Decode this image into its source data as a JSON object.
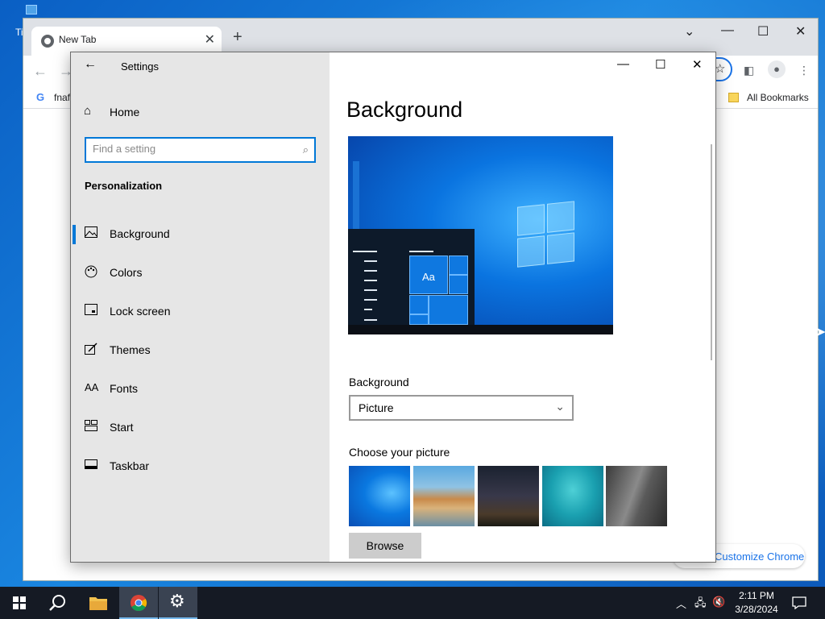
{
  "desktop": {
    "partial_label": "Ti"
  },
  "chrome": {
    "tab_title": "New Tab",
    "tab_close": "✕",
    "new_tab": "+",
    "bookmark_letter": "G",
    "bookmark_text": "fnaf",
    "all_bookmarks": "All Bookmarks",
    "customize": "Customize Chrome",
    "controls": {
      "dropdown": "⌄",
      "minimize": "—",
      "maximize": "☐",
      "close": "✕"
    }
  },
  "settings": {
    "title": "Settings",
    "home": "Home",
    "search_placeholder": "Find a setting",
    "section": "Personalization",
    "nav": [
      {
        "label": "Background",
        "icon": "picture-icon",
        "selected": true
      },
      {
        "label": "Colors",
        "icon": "palette-icon"
      },
      {
        "label": "Lock screen",
        "icon": "lock-screen-icon"
      },
      {
        "label": "Themes",
        "icon": "themes-icon"
      },
      {
        "label": "Fonts",
        "icon": "fonts-icon"
      },
      {
        "label": "Start",
        "icon": "start-icon"
      },
      {
        "label": "Taskbar",
        "icon": "taskbar-icon"
      }
    ],
    "page_title": "Background",
    "preview_tile_text": "Aa",
    "background_label": "Background",
    "background_value": "Picture",
    "choose_label": "Choose your picture",
    "browse": "Browse",
    "thumbnails": [
      "windows-blue-wallpaper",
      "beach-sunset-rock",
      "night-sky-tent",
      "underwater-swimmer",
      "rock-cliff"
    ]
  },
  "taskbar": {
    "time": "2:11 PM",
    "date": "3/28/2024"
  }
}
